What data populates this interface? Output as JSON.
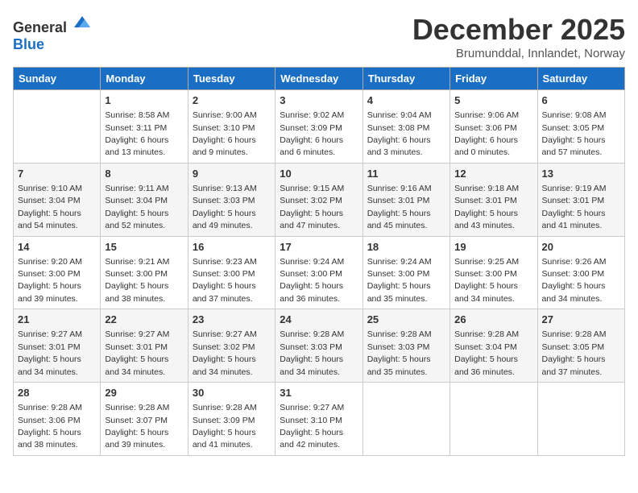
{
  "logo": {
    "general": "General",
    "blue": "Blue"
  },
  "title": "December 2025",
  "location": "Brumunddal, Innlandet, Norway",
  "days_of_week": [
    "Sunday",
    "Monday",
    "Tuesday",
    "Wednesday",
    "Thursday",
    "Friday",
    "Saturday"
  ],
  "weeks": [
    [
      {
        "day": "",
        "info": ""
      },
      {
        "day": "1",
        "info": "Sunrise: 8:58 AM\nSunset: 3:11 PM\nDaylight: 6 hours\nand 13 minutes."
      },
      {
        "day": "2",
        "info": "Sunrise: 9:00 AM\nSunset: 3:10 PM\nDaylight: 6 hours\nand 9 minutes."
      },
      {
        "day": "3",
        "info": "Sunrise: 9:02 AM\nSunset: 3:09 PM\nDaylight: 6 hours\nand 6 minutes."
      },
      {
        "day": "4",
        "info": "Sunrise: 9:04 AM\nSunset: 3:08 PM\nDaylight: 6 hours\nand 3 minutes."
      },
      {
        "day": "5",
        "info": "Sunrise: 9:06 AM\nSunset: 3:06 PM\nDaylight: 6 hours\nand 0 minutes."
      },
      {
        "day": "6",
        "info": "Sunrise: 9:08 AM\nSunset: 3:05 PM\nDaylight: 5 hours\nand 57 minutes."
      }
    ],
    [
      {
        "day": "7",
        "info": "Sunrise: 9:10 AM\nSunset: 3:04 PM\nDaylight: 5 hours\nand 54 minutes."
      },
      {
        "day": "8",
        "info": "Sunrise: 9:11 AM\nSunset: 3:04 PM\nDaylight: 5 hours\nand 52 minutes."
      },
      {
        "day": "9",
        "info": "Sunrise: 9:13 AM\nSunset: 3:03 PM\nDaylight: 5 hours\nand 49 minutes."
      },
      {
        "day": "10",
        "info": "Sunrise: 9:15 AM\nSunset: 3:02 PM\nDaylight: 5 hours\nand 47 minutes."
      },
      {
        "day": "11",
        "info": "Sunrise: 9:16 AM\nSunset: 3:01 PM\nDaylight: 5 hours\nand 45 minutes."
      },
      {
        "day": "12",
        "info": "Sunrise: 9:18 AM\nSunset: 3:01 PM\nDaylight: 5 hours\nand 43 minutes."
      },
      {
        "day": "13",
        "info": "Sunrise: 9:19 AM\nSunset: 3:01 PM\nDaylight: 5 hours\nand 41 minutes."
      }
    ],
    [
      {
        "day": "14",
        "info": "Sunrise: 9:20 AM\nSunset: 3:00 PM\nDaylight: 5 hours\nand 39 minutes."
      },
      {
        "day": "15",
        "info": "Sunrise: 9:21 AM\nSunset: 3:00 PM\nDaylight: 5 hours\nand 38 minutes."
      },
      {
        "day": "16",
        "info": "Sunrise: 9:23 AM\nSunset: 3:00 PM\nDaylight: 5 hours\nand 37 minutes."
      },
      {
        "day": "17",
        "info": "Sunrise: 9:24 AM\nSunset: 3:00 PM\nDaylight: 5 hours\nand 36 minutes."
      },
      {
        "day": "18",
        "info": "Sunrise: 9:24 AM\nSunset: 3:00 PM\nDaylight: 5 hours\nand 35 minutes."
      },
      {
        "day": "19",
        "info": "Sunrise: 9:25 AM\nSunset: 3:00 PM\nDaylight: 5 hours\nand 34 minutes."
      },
      {
        "day": "20",
        "info": "Sunrise: 9:26 AM\nSunset: 3:00 PM\nDaylight: 5 hours\nand 34 minutes."
      }
    ],
    [
      {
        "day": "21",
        "info": "Sunrise: 9:27 AM\nSunset: 3:01 PM\nDaylight: 5 hours\nand 34 minutes."
      },
      {
        "day": "22",
        "info": "Sunrise: 9:27 AM\nSunset: 3:01 PM\nDaylight: 5 hours\nand 34 minutes."
      },
      {
        "day": "23",
        "info": "Sunrise: 9:27 AM\nSunset: 3:02 PM\nDaylight: 5 hours\nand 34 minutes."
      },
      {
        "day": "24",
        "info": "Sunrise: 9:28 AM\nSunset: 3:03 PM\nDaylight: 5 hours\nand 34 minutes."
      },
      {
        "day": "25",
        "info": "Sunrise: 9:28 AM\nSunset: 3:03 PM\nDaylight: 5 hours\nand 35 minutes."
      },
      {
        "day": "26",
        "info": "Sunrise: 9:28 AM\nSunset: 3:04 PM\nDaylight: 5 hours\nand 36 minutes."
      },
      {
        "day": "27",
        "info": "Sunrise: 9:28 AM\nSunset: 3:05 PM\nDaylight: 5 hours\nand 37 minutes."
      }
    ],
    [
      {
        "day": "28",
        "info": "Sunrise: 9:28 AM\nSunset: 3:06 PM\nDaylight: 5 hours\nand 38 minutes."
      },
      {
        "day": "29",
        "info": "Sunrise: 9:28 AM\nSunset: 3:07 PM\nDaylight: 5 hours\nand 39 minutes."
      },
      {
        "day": "30",
        "info": "Sunrise: 9:28 AM\nSunset: 3:09 PM\nDaylight: 5 hours\nand 41 minutes."
      },
      {
        "day": "31",
        "info": "Sunrise: 9:27 AM\nSunset: 3:10 PM\nDaylight: 5 hours\nand 42 minutes."
      },
      {
        "day": "",
        "info": ""
      },
      {
        "day": "",
        "info": ""
      },
      {
        "day": "",
        "info": ""
      }
    ]
  ]
}
